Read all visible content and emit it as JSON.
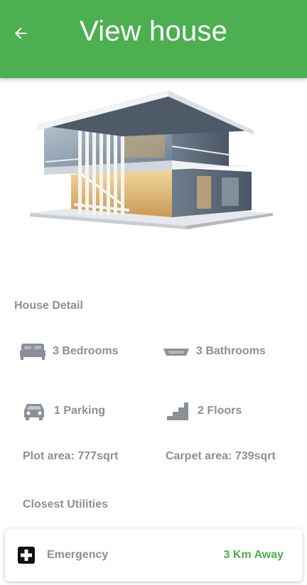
{
  "app_bar": {
    "title": "View house",
    "back_icon": "arrow-left-icon",
    "color": "#4caf50"
  },
  "hero": {
    "description_icon": "house-image"
  },
  "house_detail": {
    "title": "House Detail",
    "features": [
      {
        "icon": "bed-icon",
        "label": "3 Bedrooms"
      },
      {
        "icon": "bathtub-icon",
        "label": "3 Bathrooms"
      },
      {
        "icon": "car-icon",
        "label": "1 Parking"
      },
      {
        "icon": "stairs-icon",
        "label": "2 Floors"
      }
    ],
    "plot_area": "Plot area: 777sqrt",
    "carpet_area": "Carpet area: 739sqrt"
  },
  "utilities": {
    "title": "Closest Utilities",
    "items": [
      {
        "icon": "medical-cross-icon",
        "name": "Emergency",
        "distance": "3 Km Away",
        "distance_color": "#4caf50"
      }
    ]
  }
}
